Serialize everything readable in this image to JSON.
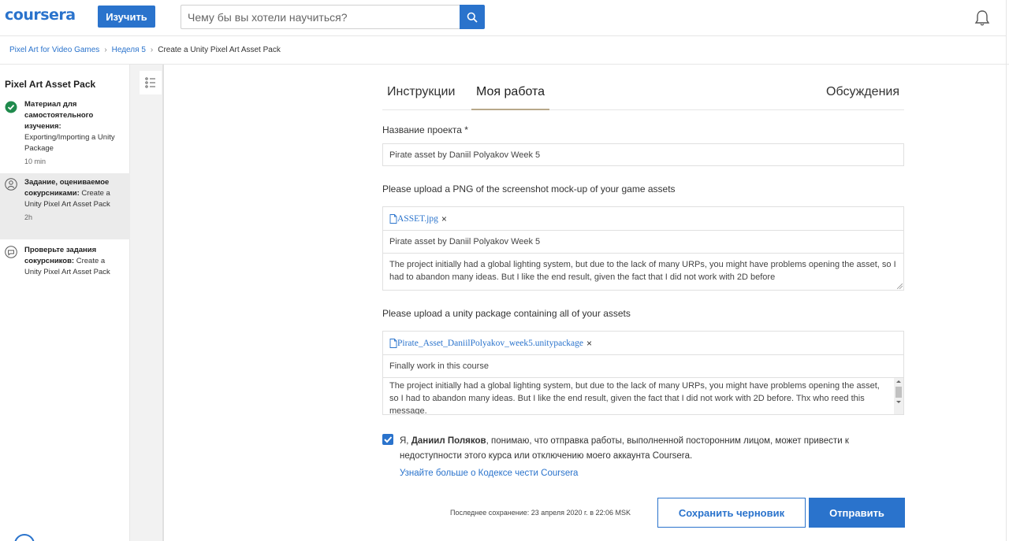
{
  "header": {
    "logo": "coursera",
    "explore_label": "Изучить",
    "search_placeholder": "Чему бы вы хотели научиться?",
    "search_icon": "search-icon",
    "bell_icon": "bell-icon",
    "accent_color": "#2a73cc"
  },
  "breadcrumb": {
    "items": [
      "Pixel Art for Video Games",
      "Неделя 5",
      "Create a Unity Pixel Art Asset Pack"
    ]
  },
  "sidebar": {
    "title": "Pixel Art Asset Pack",
    "items": [
      {
        "bold": "Материал для самостоятельного изучения:",
        "text": " Exporting/Importing a Unity Package",
        "duration": "10 min",
        "icon": "check-circle-icon",
        "status": "completed"
      },
      {
        "bold": "Задание, оцениваемое сокурсниками:",
        "text": " Create a Unity Pixel Art Asset Pack",
        "duration": "2h",
        "icon": "peer-review-icon",
        "status": "active"
      },
      {
        "bold": "Проверьте задания сокурсников:",
        "text": " Create a Unity Pixel Art Asset Pack",
        "duration": "",
        "icon": "chat-bubble-icon",
        "status": "pending"
      }
    ]
  },
  "tabs": [
    {
      "label": "Инструкции"
    },
    {
      "label": "Моя работа"
    },
    {
      "label": "Обсуждения"
    }
  ],
  "form": {
    "project_name_label": "Название проекта *",
    "project_name_value": "Pirate asset by Daniil Polyakov Week 5",
    "q1": {
      "label": "Please upload a PNG of the screenshot mock-up of your game assets",
      "file_name": "ASSET.jpg",
      "remove_symbol": "×",
      "title_value": "Pirate asset by Daniil Polyakov Week 5",
      "description": "The project initially had a global lighting system, but due to the lack of many URPs, you might have problems opening the asset, so I had to abandon many ideas. But I like the end result, given the fact that I did not work with 2D before"
    },
    "q2": {
      "label": "Please upload a unity package containing all of your assets",
      "file_name": "Pirate_Asset_DaniilPolyakov_week5.unitypackage",
      "remove_symbol": "×",
      "title_value": "Finally work in this course",
      "description": "The project initially had a global lighting system, but due to the lack of many URPs, you might have problems opening the asset, so I had to abandon many ideas. But I like the end result, given the fact that I did not work with 2D before. Thx who reed this message."
    }
  },
  "honor": {
    "prefix": "Я, ",
    "name": "Даниил Поляков",
    "text": ", понимаю, что отправка работы, выполненной посторонним лицом, может привести к недоступности этого курса или отключению моего аккаунта Coursera.",
    "link": "Узнайте больше о Кодексе чести Coursera",
    "checked": true
  },
  "footer": {
    "save_status": "Последнее сохранение: 23 апреля 2020 г. в 22:06 MSK",
    "draft_label": "Сохранить черновик",
    "submit_label": "Отправить"
  }
}
